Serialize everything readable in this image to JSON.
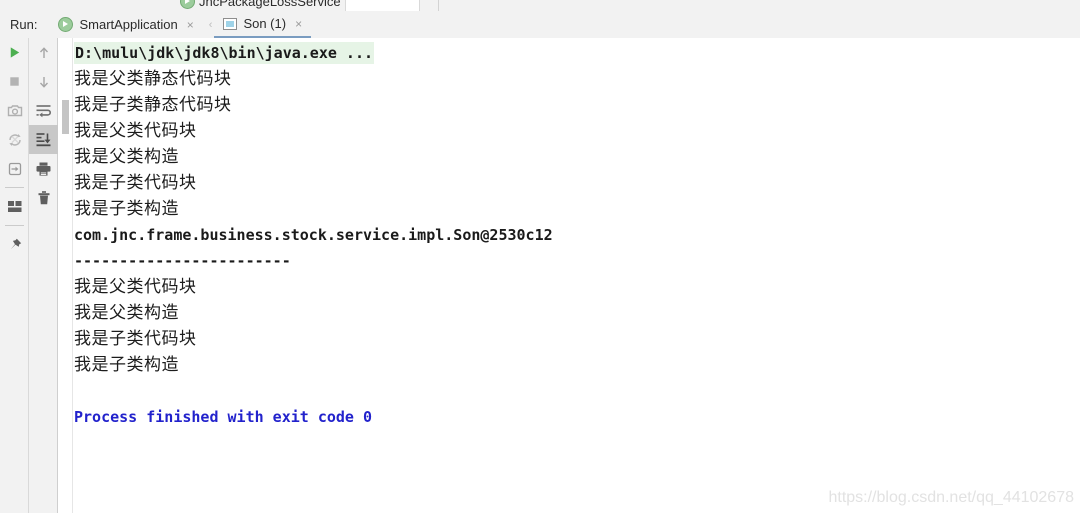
{
  "window": {
    "editor_tab_partial": "JncPackageLossService"
  },
  "run_panel": {
    "label": "Run:",
    "tabs": [
      {
        "name": "SmartApplication",
        "icon": "run-config-icon",
        "selected": false,
        "close": "×"
      },
      {
        "name": "Son (1)",
        "icon": "console-icon",
        "selected": true,
        "close": "×"
      }
    ],
    "chevron": "‹"
  },
  "toolbar_left": {
    "buttons": [
      {
        "id": "rerun",
        "name": "rerun-button",
        "glyph": "play-icon",
        "color": "#4caf50",
        "active": false
      },
      {
        "id": "stop",
        "name": "stop-button",
        "glyph": "stop-icon",
        "color": "#b0b0b0",
        "active": false
      },
      {
        "id": "camera",
        "name": "camera-icon",
        "glyph": "camera-icon",
        "color": "#b0b0b0",
        "active": false
      },
      {
        "id": "rerun-failed",
        "name": "rerun-failed-tests-button",
        "glyph": "rerun-failed-icon",
        "color": "#b0b0b0",
        "active": false
      },
      {
        "id": "export",
        "name": "export-to-text-file-button",
        "glyph": "export-icon",
        "color": "#8c8c8c",
        "active": false
      },
      {
        "id": "layout",
        "name": "layout-settings-button",
        "glyph": "layout-icon",
        "color": "#5e5e5e",
        "active": false
      },
      {
        "id": "pin",
        "name": "pin-tab-button",
        "glyph": "pin-icon",
        "color": "#5e5e5e",
        "active": false
      }
    ]
  },
  "toolbar_right": {
    "buttons": [
      {
        "id": "up",
        "name": "up-the-stack-trace-button",
        "glyph": "arrow-up-icon",
        "color": "#9e9e9e",
        "active": false
      },
      {
        "id": "down",
        "name": "down-the-stack-trace-button",
        "glyph": "arrow-down-icon",
        "color": "#9e9e9e",
        "active": false
      },
      {
        "id": "softwrap",
        "name": "soft-wrap-button",
        "glyph": "soft-wrap-icon",
        "color": "#6e6e6e",
        "active": false
      },
      {
        "id": "scroll-end",
        "name": "scroll-to-end-button",
        "glyph": "scroll-to-end-icon",
        "color": "#4a4a4a",
        "active": true
      },
      {
        "id": "print",
        "name": "print-button",
        "glyph": "printer-icon",
        "color": "#5e5e5e",
        "active": false
      },
      {
        "id": "clear",
        "name": "clear-all-button",
        "glyph": "trash-icon",
        "color": "#5e5e5e",
        "active": false
      }
    ]
  },
  "console": {
    "lines": [
      {
        "kind": "cmd",
        "text": "D:\\mulu\\jdk\\jdk8\\bin\\java.exe ..."
      },
      {
        "kind": "cjk",
        "text": "我是父类静态代码块"
      },
      {
        "kind": "cjk",
        "text": "我是子类静态代码块"
      },
      {
        "kind": "cjk",
        "text": "我是父类代码块"
      },
      {
        "kind": "cjk",
        "text": "我是父类构造"
      },
      {
        "kind": "cjk",
        "text": "我是子类代码块"
      },
      {
        "kind": "cjk",
        "text": "我是子类构造"
      },
      {
        "kind": "mono",
        "text": "com.jnc.frame.business.stock.service.impl.Son@2530c12"
      },
      {
        "kind": "dash",
        "text": "------------------------"
      },
      {
        "kind": "cjk",
        "text": "我是父类代码块"
      },
      {
        "kind": "cjk",
        "text": "我是父类构造"
      },
      {
        "kind": "cjk",
        "text": "我是子类代码块"
      },
      {
        "kind": "cjk",
        "text": "我是子类构造"
      },
      {
        "kind": "blank",
        "text": " "
      },
      {
        "kind": "exit",
        "text": "Process finished with exit code 0"
      }
    ]
  },
  "watermark": {
    "text": "https://blog.csdn.net/qq_44102678"
  },
  "colors": {
    "command_highlight": "#e6f4e6",
    "exit_code_blue": "#2222cc",
    "toolbar_bg": "#f2f2f2",
    "active_button_bg": "#c8c8c8",
    "tab_underline": "#7a9cc0",
    "watermark": "#e2e2e2"
  }
}
